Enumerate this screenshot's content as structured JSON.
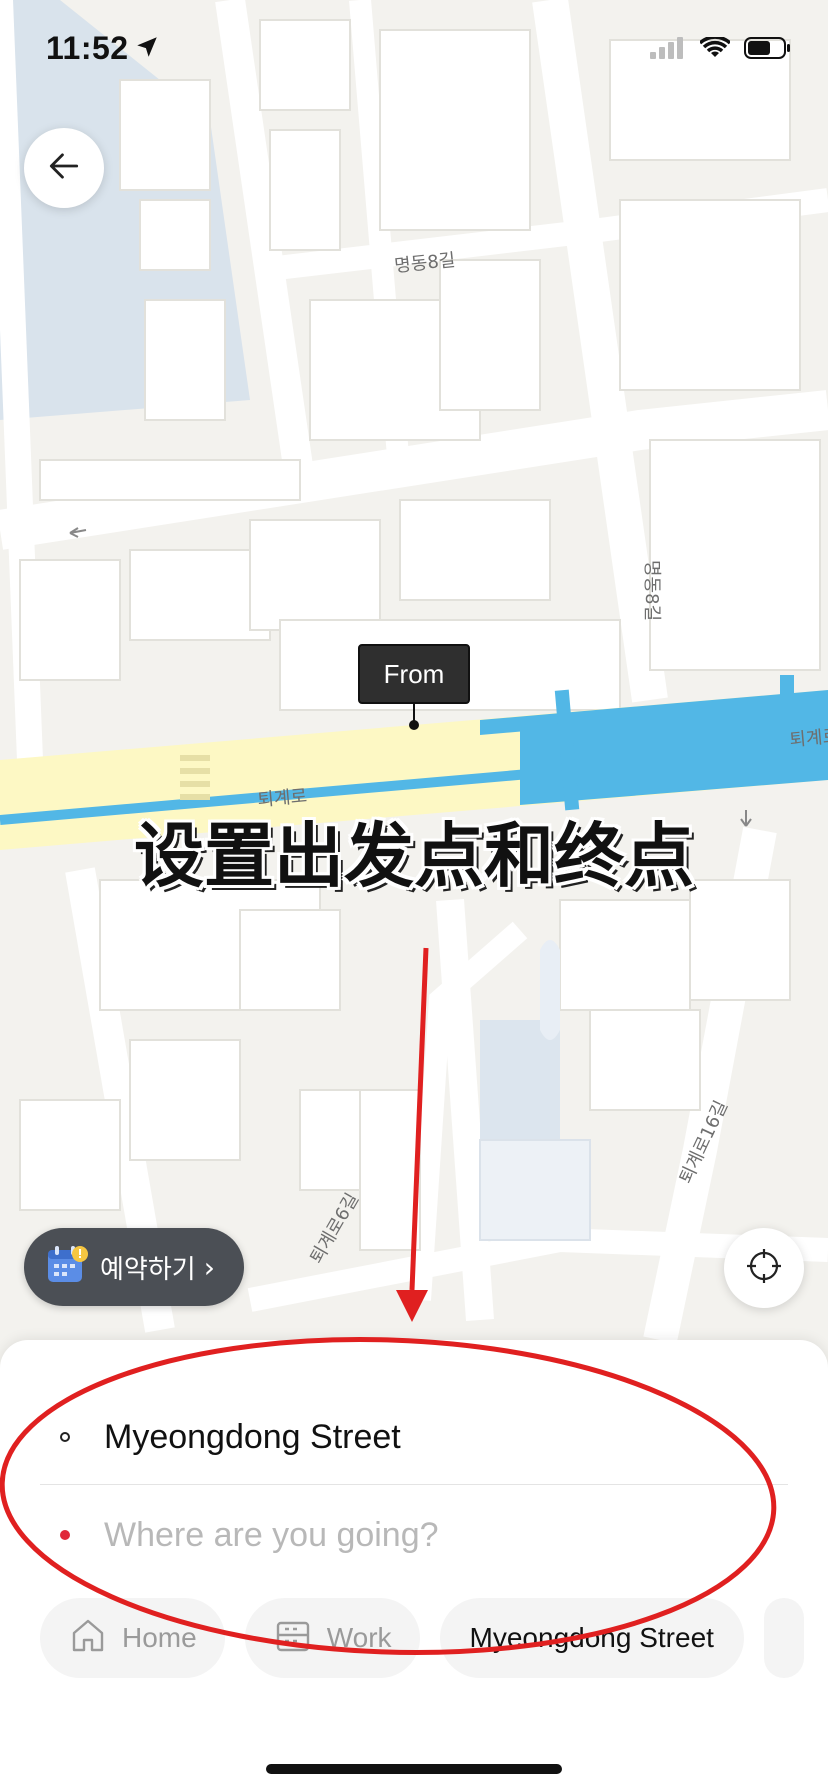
{
  "status": {
    "time": "11:52",
    "location_icon": "location-arrow-icon",
    "signal_icon": "cellular-signal-icon",
    "wifi_icon": "wifi-icon",
    "battery_icon": "battery-icon"
  },
  "map": {
    "street_labels": [
      "명동8길",
      "퇴계로",
      "퇴계로",
      "명동8길",
      "퇴계로16길",
      "퇴계로6길"
    ],
    "from_label": "From",
    "colors": {
      "road_major": "#fdf8c4",
      "transit_line": "#52b7e6",
      "water": "#d9e3ec",
      "building": "#ffffff",
      "ground": "#f3f2ee"
    }
  },
  "overlay": {
    "caption": "设置出发点和终点",
    "annotation_color": "#e02020"
  },
  "controls": {
    "back_icon": "arrow-left-icon",
    "reserve_label": "예약하기",
    "reserve_chevron": "›",
    "reserve_icon": "calendar-icon",
    "locate_icon": "crosshair-icon"
  },
  "route": {
    "origin": "Myeongdong Street",
    "destination_placeholder": "Where are you going?",
    "destination_value": "",
    "origin_marker_color": "#222222",
    "destination_marker_color": "#e0283a"
  },
  "shortcuts": [
    {
      "label": "Home",
      "icon": "home-icon"
    },
    {
      "label": "Work",
      "icon": "briefcase-icon"
    },
    {
      "label": "Myeongdong Street",
      "icon": ""
    }
  ]
}
